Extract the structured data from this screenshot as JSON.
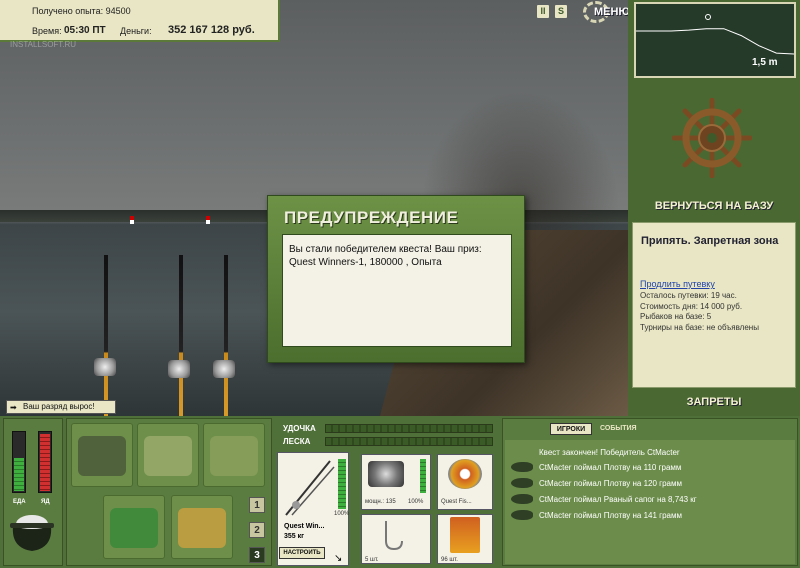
{
  "info": {
    "experience_label": "Получено опыта:",
    "experience_value": "94500",
    "time_label": "Время:",
    "time_value": "05:30 ПТ",
    "money_label": "Деньги:",
    "money_value": "352 167 128 руб."
  },
  "watermark": "INSTALLSOFT.RU",
  "topbar": {
    "pause_icon": "II",
    "sound_icon": "S",
    "menu_label": "МЕНЮ"
  },
  "depth": {
    "value": "1,5 m",
    "profile": [
      0.5,
      0.5,
      0.5,
      0.48,
      0.45,
      0.45,
      0.6,
      0.82,
      0.98,
      1.0
    ]
  },
  "right": {
    "back_label": "ВЕРНУТЬСЯ НА БАЗУ",
    "location_title": "Припять. Запретная зона",
    "extend_link": "Продлить путевку",
    "rows": [
      "Осталось путевки: 19 час.",
      "Стоимость дня: 14 000 руб.",
      "Рыбаков на базе: 5",
      "Турниры на базе: не объявлены"
    ],
    "bans_label": "ЗАПРЕТЫ"
  },
  "dialog": {
    "title": "ПРЕДУПРЕЖДЕНИЕ",
    "body": "Вы стали победителем квеста! Ваш приз: Quest Winners-1, 180000 , Опыта"
  },
  "rank_notice": "Ваш разряд вырос!",
  "vitals": {
    "food_label": "ЕДА",
    "poison_label": "ЯД",
    "food_level": 0.55,
    "poison_level": 0.95
  },
  "inventory": {
    "tabs": [
      "1",
      "2",
      "3"
    ],
    "active_tab": "3"
  },
  "tackle": {
    "rod_label": "УДОЧКА",
    "line_label": "ЛЕСКА",
    "rod_name": "Quest Win...",
    "rod_weight": "355 кг",
    "rod_percent": "100%",
    "reel_label": "мощн.: 135",
    "reel_percent": "100%",
    "line_name": "Quest Fis...",
    "hook_count": "5 шт.",
    "bait_count": "96 шт.",
    "setup_label": "НАСТРОИТЬ"
  },
  "events": {
    "tab_players": "ИГРОКИ",
    "tab_events": "СОБЫТИЯ",
    "rows": [
      "Квест закончен! Победитель CtMacter",
      "CtMacter поймал Плотву на 110 грамм",
      "CtMacter поймал Плотву на 120 грамм",
      "CtMacter поймал Рваный сапог на 8,743 кг",
      "CtMacter поймал Плотву на 141 грамм"
    ]
  },
  "colors": {
    "panel_green": "#4a6832",
    "cream": "#e8e6c4",
    "food_green": "#3fb040",
    "poison_red": "#d03030"
  }
}
